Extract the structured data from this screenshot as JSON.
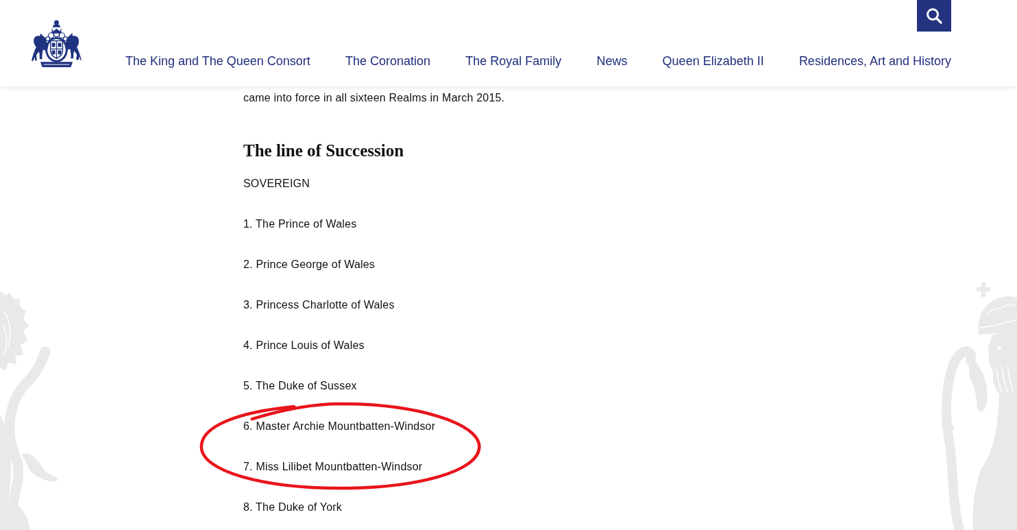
{
  "header": {
    "nav": [
      "The King and The Queen Consort",
      "The Coronation",
      "The Royal Family",
      "News",
      "Queen Elizabeth II",
      "Residences, Art and History"
    ]
  },
  "article": {
    "intro_text": "came into force in all sixteen Realms in March 2015.",
    "heading": "The line of Succession",
    "list_label": "SOVEREIGN",
    "succession": [
      {
        "text": "1. The Prince of Wales",
        "circled": false
      },
      {
        "text": "2. Prince George of Wales",
        "circled": false
      },
      {
        "text": "3. Princess Charlotte of Wales",
        "circled": false
      },
      {
        "text": "4. Prince Louis of Wales",
        "circled": false
      },
      {
        "text": "5. The Duke of Sussex",
        "circled": false
      },
      {
        "text": "6. Master Archie Mountbatten-Windsor",
        "circled": true
      },
      {
        "text": "7. Miss Lilibet Mountbatten-Windsor",
        "circled": true
      },
      {
        "text": "8. The Duke of York",
        "circled": false
      }
    ]
  }
}
